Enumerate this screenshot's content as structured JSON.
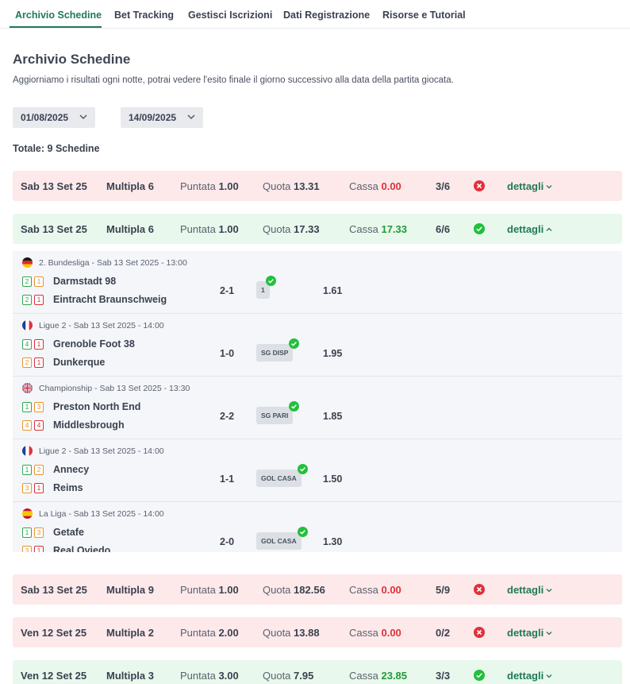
{
  "tabs": [
    {
      "label": "Archivio Schedine",
      "active": true
    },
    {
      "label": "Bet Tracking",
      "active": false
    },
    {
      "label": "Gestisci Iscrizioni",
      "active": false
    },
    {
      "label": "Dati Registrazione",
      "active": false
    },
    {
      "label": "Risorse e Tutorial",
      "active": false
    }
  ],
  "page": {
    "title": "Archivio Schedine",
    "subtitle": "Aggiorniamo i risultati ogni notte, potrai vedere l'esito finale il giorno successivo alla data della partita giocata."
  },
  "filters": {
    "date_from": "01/08/2025",
    "date_to": "14/09/2025"
  },
  "totale": "Totale: 9 Schedine",
  "labels": {
    "punt": "Puntata",
    "quota": "Quota",
    "cassa": "Cassa",
    "dettagli": "dettagli"
  },
  "slips": [
    {
      "date": "Sab 13 Set 25",
      "multipla": "Multipla 6",
      "puntata": "1.00",
      "quota": "13.31",
      "cassa": "0.00",
      "ratio": "3/6",
      "status": "lost",
      "expanded": false
    },
    {
      "date": "Sab 13 Set 25",
      "multipla": "Multipla 6",
      "puntata": "1.00",
      "quota": "17.33",
      "cassa": "17.33",
      "ratio": "6/6",
      "status": "won",
      "expanded": true
    },
    {
      "date": "Sab 13 Set 25",
      "multipla": "Multipla 9",
      "puntata": "1.00",
      "quota": "182.56",
      "cassa": "0.00",
      "ratio": "5/9",
      "status": "lost",
      "expanded": false
    },
    {
      "date": "Ven 12 Set 25",
      "multipla": "Multipla 2",
      "puntata": "2.00",
      "quota": "13.88",
      "cassa": "0.00",
      "ratio": "0/2",
      "status": "lost",
      "expanded": false
    },
    {
      "date": "Ven 12 Set 25",
      "multipla": "Multipla 3",
      "puntata": "3.00",
      "quota": "7.95",
      "cassa": "23.85",
      "ratio": "3/3",
      "status": "won",
      "expanded": false
    }
  ],
  "matches": [
    {
      "league": "2. Bundesliga - Sab 13 Set 2025 - 13:00",
      "flag": "de-flag",
      "home": {
        "name": "Darmstadt 98",
        "pos": [
          "2",
          "1"
        ]
      },
      "away": {
        "name": "Eintracht Braunschweig",
        "pos": [
          "2",
          "1"
        ]
      },
      "score": "2-1",
      "pick": "1",
      "odd": "1.61"
    },
    {
      "league": "Ligue 2 - Sab 13 Set 2025 - 14:00",
      "flag": "fr-flag",
      "home": {
        "name": "Grenoble Foot 38",
        "pos": [
          "4",
          "1"
        ]
      },
      "away": {
        "name": "Dunkerque",
        "pos": [
          "2",
          "1"
        ]
      },
      "score": "1-0",
      "pick": "SG DISP",
      "odd": "1.95"
    },
    {
      "league": "Championship - Sab 13 Set 2025 - 13:30",
      "flag": "gb-flag",
      "home": {
        "name": "Preston North End",
        "pos": [
          "1",
          "3"
        ]
      },
      "away": {
        "name": "Middlesbrough",
        "pos": [
          "4",
          "4"
        ]
      },
      "score": "2-2",
      "pick": "SG PARI",
      "odd": "1.85"
    },
    {
      "league": "Ligue 2 - Sab 13 Set 2025 - 14:00",
      "flag": "fr-flag",
      "home": {
        "name": "Annecy",
        "pos": [
          "1",
          "2"
        ]
      },
      "away": {
        "name": "Reims",
        "pos": [
          "3",
          "1"
        ]
      },
      "score": "1-1",
      "pick": "GOL CASA",
      "odd": "1.50"
    },
    {
      "league": "La Liga - Sab 13 Set 2025 - 14:00",
      "flag": "es-flag",
      "home": {
        "name": "Getafe",
        "pos": [
          "1",
          "3"
        ]
      },
      "away": {
        "name": "Real Oviedo",
        "pos": [
          "3",
          "1"
        ]
      },
      "score": "2-0",
      "pick": "GOL CASA",
      "odd": "1.30"
    }
  ],
  "colors": {
    "accent": "#1f7a55",
    "lost_bg": "#fde9ea",
    "won_bg": "#e9f8ec",
    "red": "#e0313b",
    "green": "#1f9a3a"
  }
}
